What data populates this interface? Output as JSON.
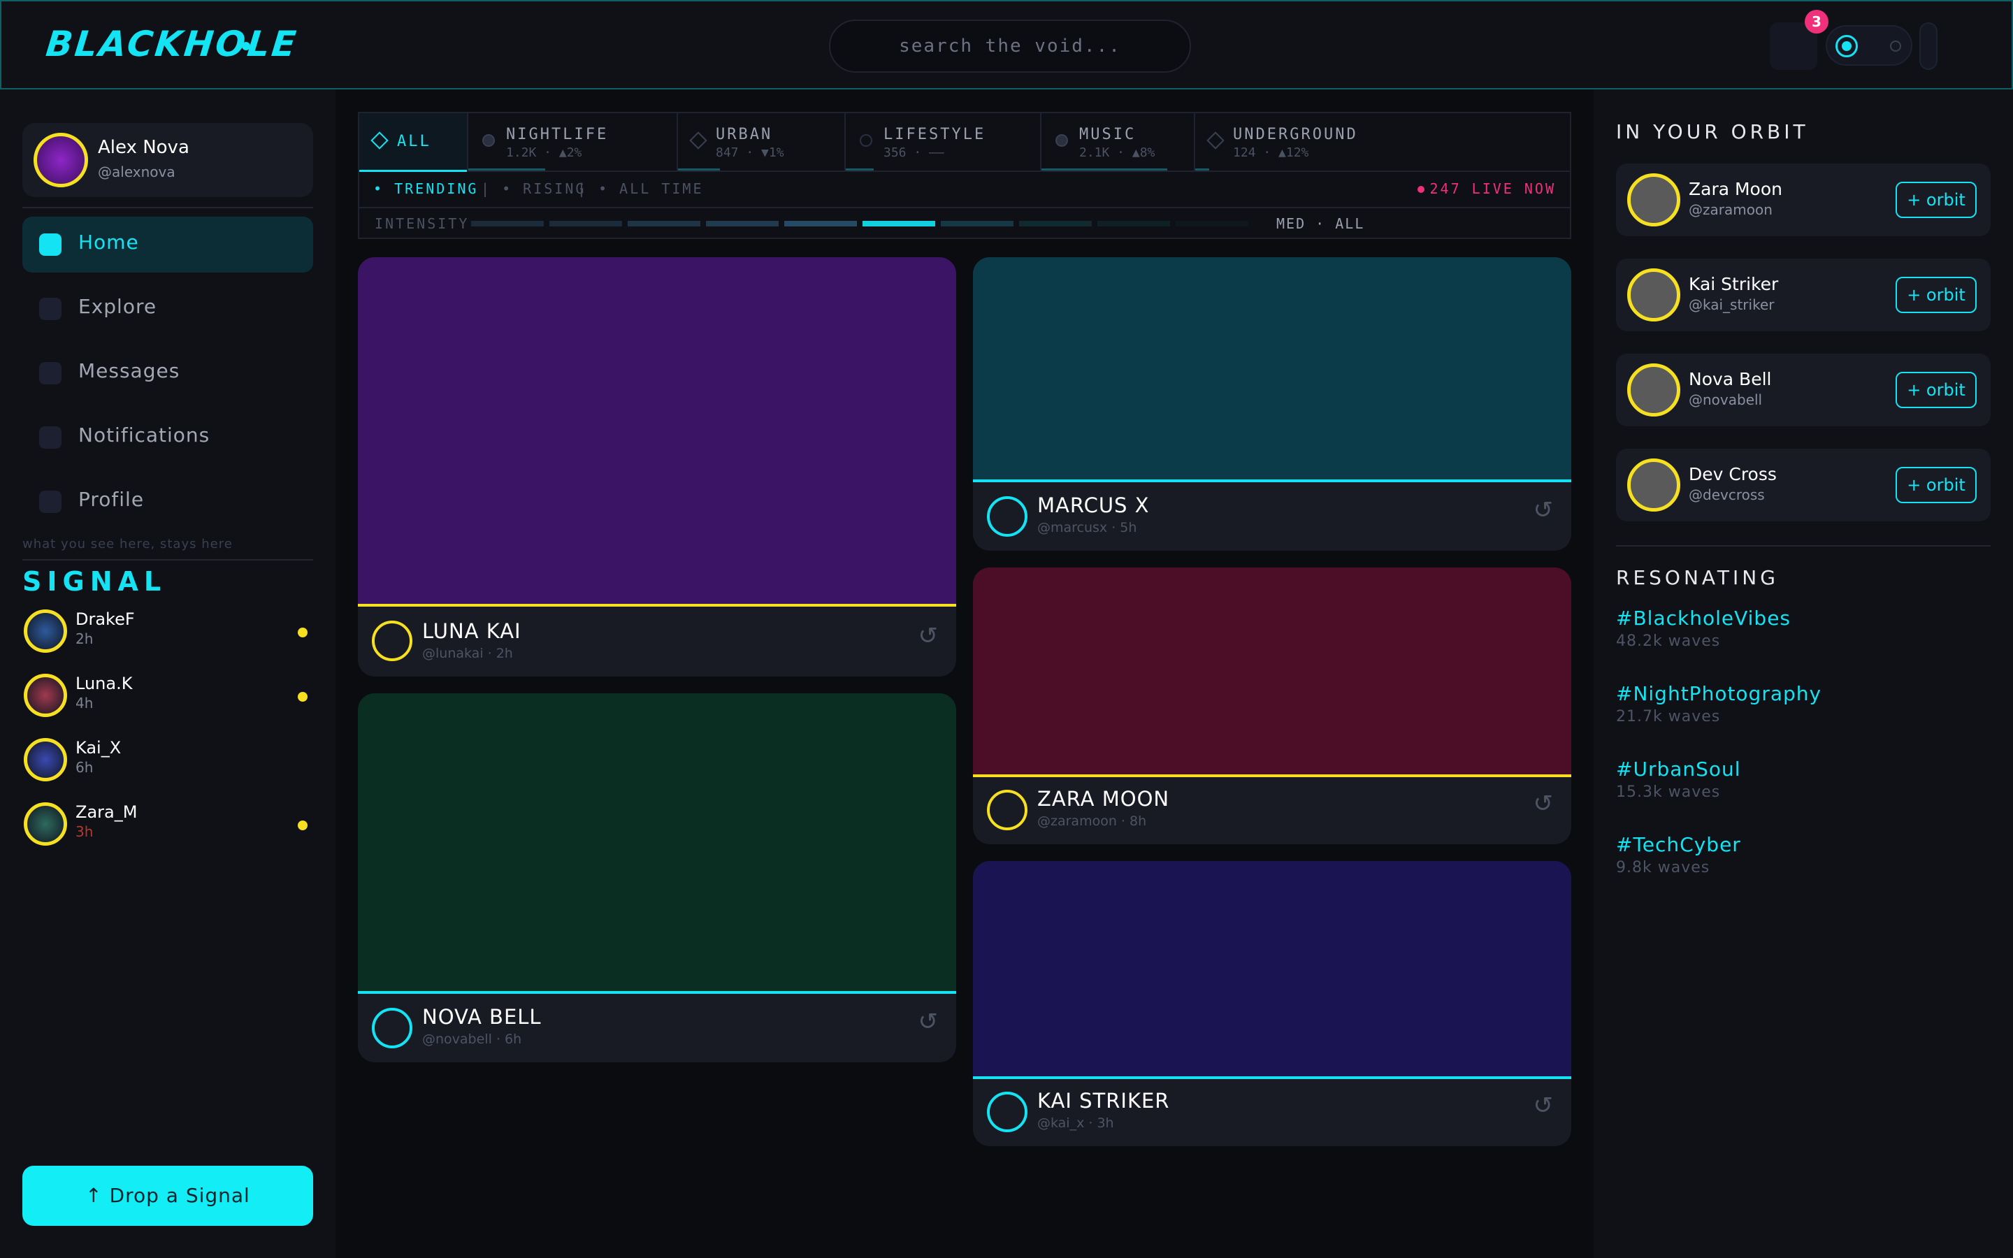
{
  "header": {
    "logo": "BLACKHOLE",
    "search_placeholder": "search the void...",
    "notification_count": "3"
  },
  "user": {
    "name": "Alex Nova",
    "handle": "@alexnova"
  },
  "nav": [
    {
      "label": "Home",
      "active": true
    },
    {
      "label": "Explore"
    },
    {
      "label": "Messages"
    },
    {
      "label": "Notifications"
    },
    {
      "label": "Profile"
    }
  ],
  "tagline": "what you see here, stays here",
  "signal": {
    "title": "SIGNAL",
    "items": [
      {
        "name": "DrakeF",
        "time": "2h",
        "unread": true,
        "color": "#2e5a9c"
      },
      {
        "name": "Luna.K",
        "time": "4h",
        "unread": true,
        "color": "#a03a4e"
      },
      {
        "name": "Kai_X",
        "time": "6h",
        "unread": false,
        "color": "#3a4ab0"
      },
      {
        "name": "Zara_M",
        "time": "3h",
        "unread": true,
        "color": "#2e6a5e"
      }
    ]
  },
  "drop_button": "↑  Drop a Signal",
  "categories": [
    {
      "name": "ALL",
      "stats": "",
      "active": true
    },
    {
      "name": "NIGHTLIFE",
      "stats": "1.2K · ▲2%"
    },
    {
      "name": "URBAN",
      "stats": "847 · ▼1%"
    },
    {
      "name": "LIFESTYLE",
      "stats": "356 · ——"
    },
    {
      "name": "MUSIC",
      "stats": "2.1K · ▲8%"
    },
    {
      "name": "UNDERGROUND",
      "stats": "124 · ▲12%"
    }
  ],
  "filters": {
    "trending": "TRENDING",
    "rising": "RISING",
    "all_time": "ALL TIME",
    "live": "247 LIVE NOW"
  },
  "intensity": {
    "label": "INTENSITY",
    "value": "MED · ALL",
    "level": 6,
    "segments": 10
  },
  "posts": [
    {
      "name": "LUNA KAI",
      "meta": "@lunakai · 2h",
      "image_color": "#3b1466",
      "line_color": "#f7e020",
      "avatar_color": "#f7e020"
    },
    {
      "name": "NOVA BELL",
      "meta": "@novabell · 6h",
      "image_color": "#0b2e22",
      "line_color": "#13e3f2",
      "avatar_color": "#13e3f2"
    },
    {
      "name": "MARCUS X",
      "meta": "@marcusx · 5h",
      "image_color": "#0b3a48",
      "line_color": "#13e3f2",
      "avatar_color": "#13e3f2"
    },
    {
      "name": "ZARA MOON",
      "meta": "@zaramoon · 8h",
      "image_color": "#4c0d26",
      "line_color": "#f7e020",
      "avatar_color": "#f7e020"
    },
    {
      "name": "KAI STRIKER",
      "meta": "@kai_x · 3h",
      "image_color": "#1a1452",
      "line_color": "#13e3f2",
      "avatar_color": "#13e3f2"
    }
  ],
  "orbit": {
    "title": "IN YOUR ORBIT",
    "button_label": "+ orbit",
    "people": [
      {
        "name": "Zara Moon",
        "handle": "@zaramoon"
      },
      {
        "name": "Kai Striker",
        "handle": "@kai_striker"
      },
      {
        "name": "Nova Bell",
        "handle": "@novabell"
      },
      {
        "name": "Dev Cross",
        "handle": "@devcross"
      }
    ]
  },
  "resonating": {
    "title": "RESONATING",
    "tags": [
      {
        "tag": "#BlackholeVibes",
        "count": "48.2k waves"
      },
      {
        "tag": "#NightPhotography",
        "count": "21.7k waves"
      },
      {
        "tag": "#UrbanSoul",
        "count": "15.3k waves"
      },
      {
        "tag": "#TechCyber",
        "count": "9.8k waves"
      }
    ]
  }
}
